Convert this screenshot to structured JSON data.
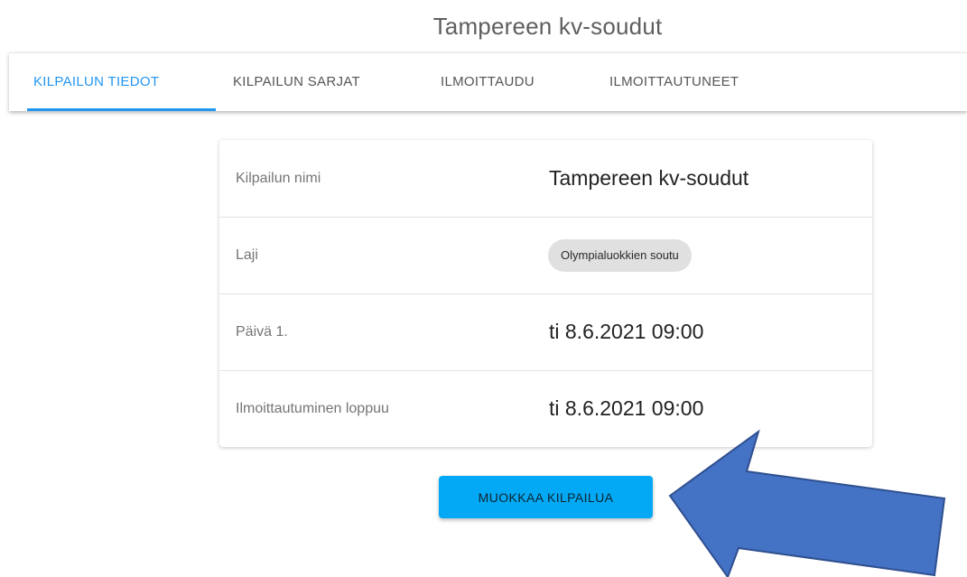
{
  "app": {
    "title": "Tampereen kv-soudut"
  },
  "tabs": [
    {
      "label": "KILPAILUN TIEDOT",
      "active": true
    },
    {
      "label": "KILPAILUN SARJAT",
      "active": false
    },
    {
      "label": "ILMOITTAUDU",
      "active": false
    },
    {
      "label": "ILMOITTAUTUNEET",
      "active": false
    }
  ],
  "details": {
    "name_label": "Kilpailun nimi",
    "name_value": "Tampereen kv-soudut",
    "sport_label": "Laji",
    "sport_value": "Olympialuokkien soutu",
    "day1_label": "Päivä 1.",
    "day1_value": "ti 8.6.2021 09:00",
    "registration_end_label": "Ilmoittautuminen loppuu",
    "registration_end_value": "ti 8.6.2021 09:00"
  },
  "actions": {
    "edit_label": "MUOKKAA KILPAILUA"
  },
  "annotation": {
    "arrow_icon": "arrow-left-icon",
    "arrow_color": "#4472c4",
    "arrow_outline": "#2f4f8f"
  },
  "colors": {
    "accent": "#2196f3",
    "button": "#03a9f4",
    "chip": "#e0e0e0"
  }
}
